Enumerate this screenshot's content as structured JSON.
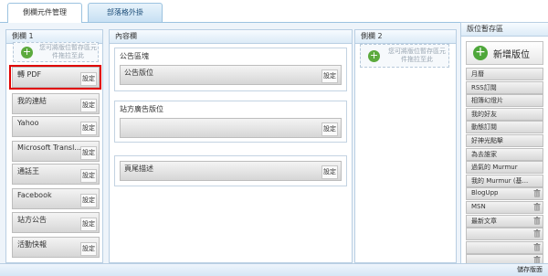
{
  "tabs": {
    "active": "側欄元件管理",
    "other": "部落格外掛"
  },
  "col1": {
    "title": "側欄 1",
    "drop_hint": "您可將版位暫存區元件拖拉至此",
    "widgets": [
      {
        "label": "轉 PDF",
        "action": "設定"
      },
      {
        "label": "我的連結",
        "action": "設定"
      },
      {
        "label": "Yahoo",
        "action": "設定"
      },
      {
        "label": "Microsoft Transl...",
        "action": "設定"
      },
      {
        "label": "通話王",
        "action": "設定"
      },
      {
        "label": "Facebook",
        "action": "設定"
      },
      {
        "label": "站方公告",
        "action": "設定"
      },
      {
        "label": "活動快報",
        "action": "設定"
      }
    ]
  },
  "content": {
    "title": "內容欄",
    "boxes": [
      {
        "title": "公告區塊",
        "bar_label": "公告版位",
        "action": "設定"
      },
      {
        "title": "站方廣告版位",
        "bar_label": "",
        "action": "設定"
      },
      {
        "title": "",
        "bar_label": "頁尾描述",
        "action": "設定"
      }
    ]
  },
  "col2": {
    "title": "側欄 2",
    "drop_hint": "您可將版位暫存區元件拖拉至此"
  },
  "pool": {
    "title": "版位暫存區",
    "new_button": "新增版位",
    "items": [
      {
        "label": "月曆",
        "trash": false
      },
      {
        "label": "RSS訂閱",
        "trash": false
      },
      {
        "label": "相簿幻燈片",
        "trash": false
      },
      {
        "label": "我的好友",
        "trash": false
      },
      {
        "label": "動態訂閱",
        "trash": false
      },
      {
        "label": "好神光點擊",
        "trash": false
      },
      {
        "label": "為去誰家",
        "trash": false
      },
      {
        "label": "過氣的 Murmur",
        "trash": false
      },
      {
        "label": "我的 Murmur (基...",
        "trash": false
      },
      {
        "label": "BlogUpp",
        "trash": true
      },
      {
        "label": "MSN",
        "trash": true
      },
      {
        "label": "最新文章",
        "trash": true
      },
      {
        "label": "",
        "trash": true
      },
      {
        "label": "",
        "trash": true
      },
      {
        "label": "",
        "trash": true
      }
    ]
  },
  "footer": {
    "save_label": "儲存版面"
  },
  "colors": {
    "highlight": "#e00000",
    "add_green": "#4ea73a",
    "accent_blue": "#9cc3e0"
  }
}
